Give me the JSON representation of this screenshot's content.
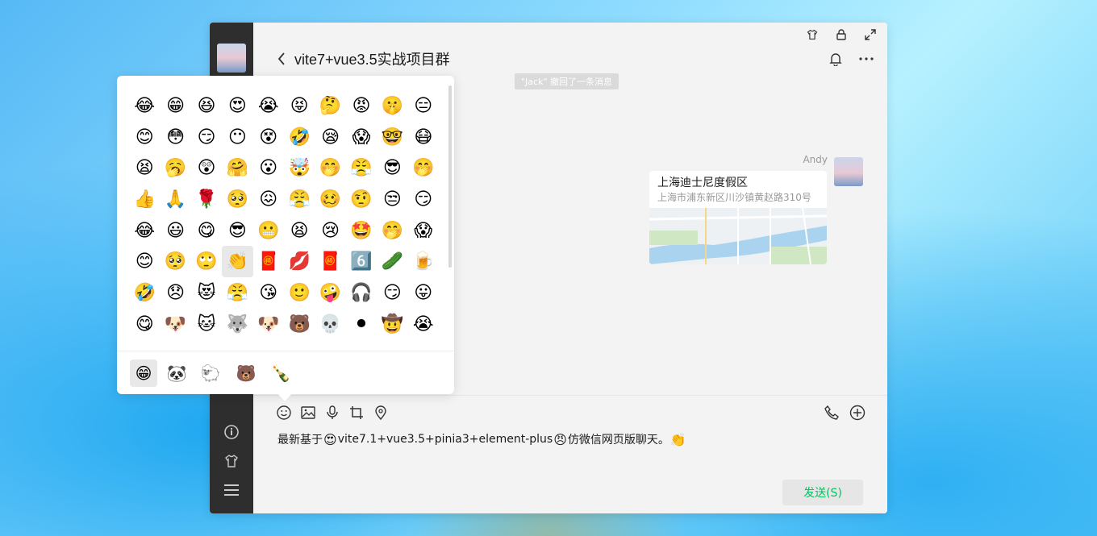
{
  "window": {
    "controls": [
      "shirt-icon",
      "lock-icon",
      "expand-icon"
    ]
  },
  "header": {
    "title": "vite7+vue3.5实战项目群"
  },
  "system_notice": "\"Jack\" 撤回了一条消息",
  "message": {
    "sender": "Andy",
    "location_title": "上海迪士尼度假区",
    "location_address": "上海市浦东新区川沙镇黄赵路310号"
  },
  "composer": {
    "draft_parts": [
      {
        "t": "text",
        "v": "最新基于"
      },
      {
        "t": "emoji",
        "v": "😍"
      },
      {
        "t": "text",
        "v": "vite7.1+vue3.5+pinia3+element-plus"
      },
      {
        "t": "emoji",
        "v": "😠"
      },
      {
        "t": "text",
        "v": "仿微信网页版聊天。"
      },
      {
        "t": "emoji",
        "v": "👏"
      }
    ],
    "send_label": "发送(S)"
  },
  "emoji_panel": {
    "emojis": [
      "😂",
      "😁",
      "😆",
      "😍",
      "😭",
      "😝",
      "🤔",
      "😡",
      "🤫",
      "😑",
      "😊",
      "😳",
      "😏",
      "😶",
      "😵",
      "🤣",
      "😪",
      "😱",
      "🤓",
      "😷",
      "😫",
      "🥱",
      "😲",
      "🤗",
      "😮",
      "🤯",
      "🤭",
      "😤",
      "😎",
      "🤭",
      "👍",
      "🙏",
      "🌹",
      "🥺",
      "😖",
      "😤",
      "🥴",
      "🤨",
      "😒",
      "😏",
      "😂",
      "😃",
      "😋",
      "😎",
      "😬",
      "😫",
      "😢",
      "🤩",
      "🤭",
      "😱",
      "😊",
      "🥺",
      "🙄",
      "👏",
      "🧧",
      "💋",
      "🧧",
      "6️⃣",
      "🥒",
      "🍺",
      "🤣",
      "😞",
      "😻",
      "😤",
      "😘",
      "🙂",
      "🤪",
      "🎧",
      "😏",
      "😛",
      "😋",
      "🐶",
      "🐱",
      "🐺",
      "🐶",
      "🐻",
      "💀",
      "⚫",
      "🤠",
      "😭"
    ],
    "selected_index": 53,
    "tabs": [
      "😁",
      "🐼",
      "🐑",
      "🐻",
      "🍾"
    ]
  }
}
